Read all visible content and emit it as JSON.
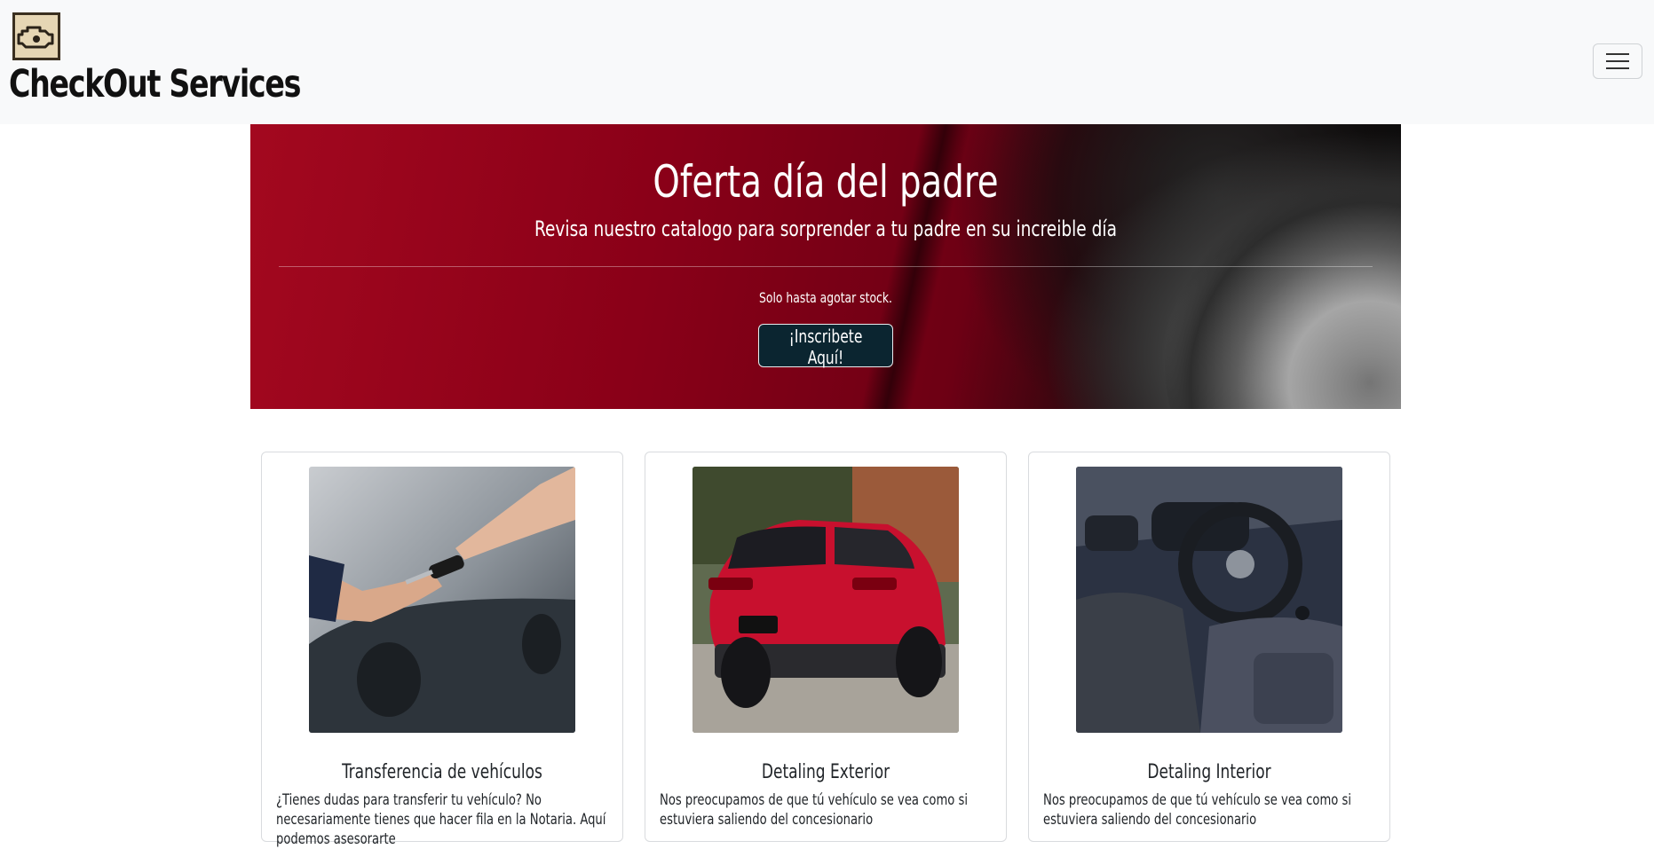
{
  "navbar": {
    "brand_name": "CheckOut Services",
    "logo_icon": "engine-check-icon",
    "menu_icon": "hamburger-menu-icon"
  },
  "hero": {
    "title": "Oferta día del padre",
    "subtitle": "Revisa nuestro catalogo para sorprender a tu padre en su increible día",
    "note": "Solo hasta agotar stock.",
    "button_label": "¡Inscribete Aquí!"
  },
  "cards": [
    {
      "title": "Transferencia de vehículos",
      "text": "¿Tienes dudas para transferir tu vehículo? No necesariamente tienes que hacer fila en la Notaria. Aquí podemos asesorarte"
    },
    {
      "title": "Detaling Exterior",
      "text": "Nos preocupamos de que tú vehículo se vea como si estuviera saliendo del concesionario"
    },
    {
      "title": "Detaling Interior",
      "text": "Nos preocupamos de que tú vehículo se vea como si estuviera saliendo del concesionario"
    }
  ],
  "colors": {
    "navbar_bg": "#f8f9fa",
    "hero_red": "#8a0018",
    "button_bg": "#0b2530"
  }
}
